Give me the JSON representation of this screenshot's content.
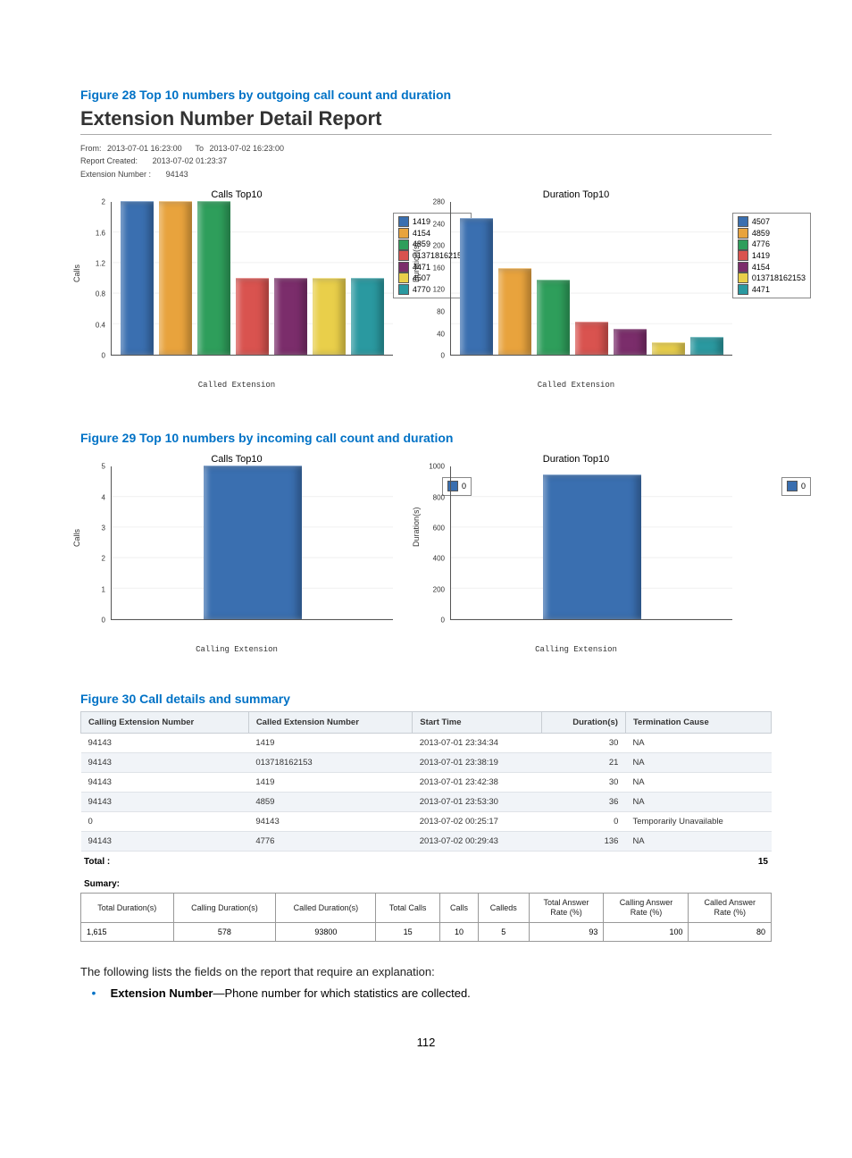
{
  "fig28": "Figure 28 Top 10 numbers by outgoing call count and duration",
  "report_title": "Extension Number Detail Report",
  "meta": {
    "from_lbl": "From:",
    "from": "2013-07-01 16:23:00",
    "to_lbl": "To",
    "to": "2013-07-02 16:23:00",
    "created_lbl": "Report Created:",
    "created": "2013-07-02 01:23:37",
    "ext_lbl": "Extension Number :",
    "ext": "94143"
  },
  "fig29": "Figure 29 Top 10 numbers by incoming call count and duration",
  "fig30": "Figure 30 Call details and summary",
  "colors": {
    "blue": "#3a6fb0",
    "orange": "#e8a33d",
    "green": "#2e9e5b",
    "red": "#d9534f",
    "purple": "#7b2d6b",
    "yellow": "#e9cf4a",
    "teal": "#2a99a0"
  },
  "chart_data": [
    {
      "id": "out_calls",
      "type": "bar",
      "title": "Calls Top10",
      "ylabel": "Calls",
      "xlabel": "Called Extension",
      "ylim": [
        0,
        2
      ],
      "yticks": [
        0,
        0.4,
        0.8,
        1.2,
        1.6,
        2
      ],
      "series": [
        {
          "name": "1419",
          "color": "blue",
          "value": 2
        },
        {
          "name": "4154",
          "color": "orange",
          "value": 2
        },
        {
          "name": "4859",
          "color": "green",
          "value": 2
        },
        {
          "name": "013718162153",
          "color": "red",
          "value": 1
        },
        {
          "name": "4471",
          "color": "purple",
          "value": 1
        },
        {
          "name": "4507",
          "color": "yellow",
          "value": 1
        },
        {
          "name": "4770",
          "color": "teal",
          "value": 1
        }
      ]
    },
    {
      "id": "out_duration",
      "type": "bar",
      "title": "Duration Top10",
      "ylabel": "Duration(s)",
      "xlabel": "Called Extension",
      "ylim": [
        0,
        280
      ],
      "yticks": [
        0,
        40,
        80,
        120,
        160,
        200,
        240,
        280
      ],
      "series": [
        {
          "name": "4507",
          "color": "blue",
          "value": 250
        },
        {
          "name": "4859",
          "color": "orange",
          "value": 158
        },
        {
          "name": "4776",
          "color": "green",
          "value": 136
        },
        {
          "name": "1419",
          "color": "red",
          "value": 60
        },
        {
          "name": "4154",
          "color": "purple",
          "value": 46
        },
        {
          "name": "013718162153",
          "color": "yellow",
          "value": 21
        },
        {
          "name": "4471",
          "color": "teal",
          "value": 32
        }
      ]
    },
    {
      "id": "in_calls",
      "type": "bar",
      "title": "Calls Top10",
      "ylabel": "Calls",
      "xlabel": "Calling Extension",
      "ylim": [
        0,
        5
      ],
      "yticks": [
        0,
        1,
        2,
        3,
        4,
        5
      ],
      "series": [
        {
          "name": "0",
          "color": "blue",
          "value": 5
        }
      ]
    },
    {
      "id": "in_duration",
      "type": "bar",
      "title": "Duration Top10",
      "ylabel": "Duration(s)",
      "xlabel": "Calling Extension",
      "ylim": [
        0,
        1000
      ],
      "yticks": [
        0,
        200,
        400,
        600,
        800,
        1000
      ],
      "series": [
        {
          "name": "0",
          "color": "blue",
          "value": 940
        }
      ]
    }
  ],
  "detail_headers": [
    "Calling Extension Number",
    "Called Extension Number",
    "Start Time",
    "Duration(s)",
    "Termination Cause"
  ],
  "detail_rows": [
    [
      "94143",
      "1419",
      "2013-07-01 23:34:34",
      "30",
      "NA"
    ],
    [
      "94143",
      "013718162153",
      "2013-07-01 23:38:19",
      "21",
      "NA"
    ],
    [
      "94143",
      "1419",
      "2013-07-01 23:42:38",
      "30",
      "NA"
    ],
    [
      "94143",
      "4859",
      "2013-07-01 23:53:30",
      "36",
      "NA"
    ],
    [
      "0",
      "94143",
      "2013-07-02 00:25:17",
      "0",
      "Temporarily Unavailable"
    ],
    [
      "94143",
      "4776",
      "2013-07-02 00:29:43",
      "136",
      "NA"
    ]
  ],
  "total_label": "Total :",
  "total_value": "15",
  "summary_label": "Sumary:",
  "summary_headers": [
    "Total Duration(s)",
    "Calling Duration(s)",
    "Called Duration(s)",
    "Total Calls",
    "Calls",
    "Calleds",
    "Total Answer Rate (%)",
    "Calling Answer Rate (%)",
    "Called Answer Rate (%)"
  ],
  "summary_row": [
    "1,615",
    "578",
    "93800",
    "15",
    "10",
    "5",
    "93",
    "100",
    "80"
  ],
  "body_intro": "The following lists the fields on the report that require an explanation:",
  "bullet_label": "Extension Number",
  "bullet_text": "—Phone number for which statistics are collected.",
  "page_number": "112"
}
